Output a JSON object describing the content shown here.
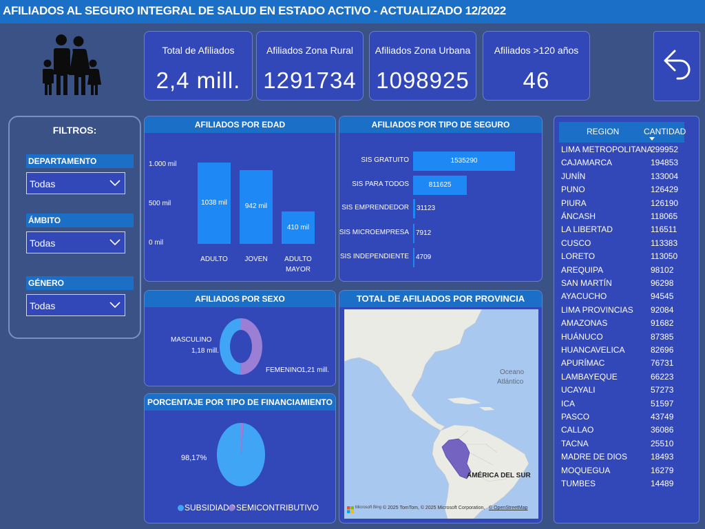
{
  "header": {
    "title": "AFILIADOS AL SEGURO INTEGRAL DE SALUD EN ESTADO ACTIVO - ACTUALIZADO 12/2022"
  },
  "kpis": [
    {
      "label": "Total de Afiliados",
      "value": "2,4 mill."
    },
    {
      "label": "Afiliados Zona Rural",
      "value": "1291734"
    },
    {
      "label": "Afiliados Zona Urbana",
      "value": "1098925"
    },
    {
      "label": "Afiliados >120 años",
      "value": "46"
    }
  ],
  "icons": {
    "family": "family-icon",
    "back": "back-arrow-icon",
    "chevron": "chevron-down-icon"
  },
  "filters": {
    "title": "FILTROS:",
    "items": [
      {
        "label": "DEPARTAMENTO",
        "value": "Todas"
      },
      {
        "label": "ÁMBITO",
        "value": "Todas"
      },
      {
        "label": "GÉNERO",
        "value": "Todas"
      }
    ]
  },
  "panels": {
    "edad": "AFILIADOS POR EDAD",
    "seguro": "AFILIADOS POR TIPO DE SEGURO",
    "sexo": "AFILIADOS POR SEXO",
    "financiamiento": "PORCENTAJE POR TIPO DE FINANCIAMIENTO",
    "mapa": "TOTAL DE AFILIADOS POR PROVINCIA"
  },
  "chart_data": [
    {
      "type": "bar",
      "title": "AFILIADOS POR EDAD",
      "categories": [
        "ADULTO",
        "JOVEN",
        "ADULTO MAYOR"
      ],
      "values": [
        1038,
        942,
        410
      ],
      "data_labels": [
        "1038 mil",
        "942 mil",
        "410 mil"
      ],
      "y_ticks": [
        "1.000 mil",
        "500 mil",
        "0 mil"
      ],
      "ylim": [
        0,
        1000
      ],
      "color": "#1e88f5"
    },
    {
      "type": "bar",
      "orientation": "horizontal",
      "title": "AFILIADOS POR TIPO DE SEGURO",
      "categories": [
        "SIS GRATUITO",
        "SIS PARA TODOS",
        "SIS EMPRENDEDOR",
        "SIS MICROEMPRESA",
        "SIS INDEPENDIENTE"
      ],
      "values": [
        1535290,
        811625,
        31123,
        7912,
        4709
      ],
      "color": "#1e88f5"
    },
    {
      "type": "pie",
      "variant": "donut",
      "title": "AFILIADOS POR SEXO",
      "labels": [
        "MASCULINO",
        "FEMENINO"
      ],
      "values": [
        1.18,
        1.21
      ],
      "data_labels": [
        "1,18 mill.",
        "1,21 mill."
      ],
      "colors": [
        "#41a5f5",
        "#9b7fd4"
      ]
    },
    {
      "type": "pie",
      "title": "PORCENTAJE POR TIPO DE FINANCIAMIENTO",
      "labels": [
        "SUBSIDIADO",
        "SEMICONTRIBUTIVO"
      ],
      "values": [
        98.17,
        1.83
      ],
      "data_label": "98,17%",
      "colors": [
        "#41a5f5",
        "#9b7fd4"
      ]
    },
    {
      "type": "table",
      "columns": [
        "REGION",
        "CANTIDAD"
      ],
      "rows": [
        [
          "LIMA METROPOLITANA",
          299952
        ],
        [
          "CAJAMARCA",
          194853
        ],
        [
          "JUNÍN",
          133004
        ],
        [
          "PUNO",
          126429
        ],
        [
          "PIURA",
          126190
        ],
        [
          "ÁNCASH",
          118065
        ],
        [
          "LA LIBERTAD",
          116511
        ],
        [
          "CUSCO",
          113383
        ],
        [
          "LORETO",
          113050
        ],
        [
          "AREQUIPA",
          98102
        ],
        [
          "SAN MARTÍN",
          96298
        ],
        [
          "AYACUCHO",
          94545
        ],
        [
          "LIMA PROVINCIAS",
          92084
        ],
        [
          "AMAZONAS",
          91682
        ],
        [
          "HUÁNUCO",
          87385
        ],
        [
          "HUANCAVELICA",
          82696
        ],
        [
          "APURÍMAC",
          76731
        ],
        [
          "LAMBAYEQUE",
          66223
        ],
        [
          "UCAYALI",
          57273
        ],
        [
          "ICA",
          51597
        ],
        [
          "PASCO",
          43749
        ],
        [
          "CALLAO",
          36086
        ],
        [
          "TACNA",
          25510
        ],
        [
          "MADRE DE DIOS",
          18493
        ],
        [
          "MOQUEGUA",
          16279
        ],
        [
          "TUMBES",
          14489
        ]
      ]
    }
  ],
  "map": {
    "ocean_label_1": "Oceano",
    "ocean_label_2": "Atlántico",
    "continent_label": "AMÉRICA DEL SUR",
    "attribution": "© 2025 TomTom, © 2025 Microsoft Corporation,",
    "attribution_link": "© OpenStreetMap",
    "bing_logo": "Microsoft Bing",
    "land_color": "#ebebe6",
    "water_color": "#a9c8ef",
    "highlight_color": "#7463c0"
  },
  "colors": {
    "background": "#3b5286",
    "panel": "#3348b8",
    "header": "#1c6fc6",
    "bar": "#1e88f5"
  }
}
